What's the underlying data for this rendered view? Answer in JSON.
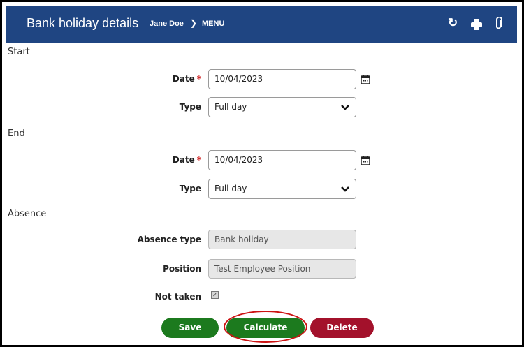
{
  "header": {
    "title": "Bank holiday details",
    "user": "Jane Doe",
    "menu_label": "MENU",
    "icons": [
      "refresh-icon",
      "print-icon",
      "attachment-icon"
    ]
  },
  "start": {
    "heading": "Start",
    "date_label": "Date",
    "date_value": "10/04/2023",
    "type_label": "Type",
    "type_value": "Full day"
  },
  "end": {
    "heading": "End",
    "date_label": "Date",
    "date_value": "10/04/2023",
    "type_label": "Type",
    "type_value": "Full day"
  },
  "absence": {
    "heading": "Absence",
    "absence_type_label": "Absence type",
    "absence_type_value": "Bank holiday",
    "position_label": "Position",
    "position_value": "Test Employee Position",
    "not_taken_label": "Not taken",
    "not_taken_checked": true
  },
  "buttons": {
    "save": "Save",
    "calculate": "Calculate",
    "delete": "Delete"
  },
  "colors": {
    "header_bg": "#1f4582",
    "save_bg": "#1c7a1e",
    "calculate_bg": "#1c7a1e",
    "delete_bg": "#a3112b",
    "highlight_ring": "#cc1212",
    "required_marker": "#d12020"
  }
}
